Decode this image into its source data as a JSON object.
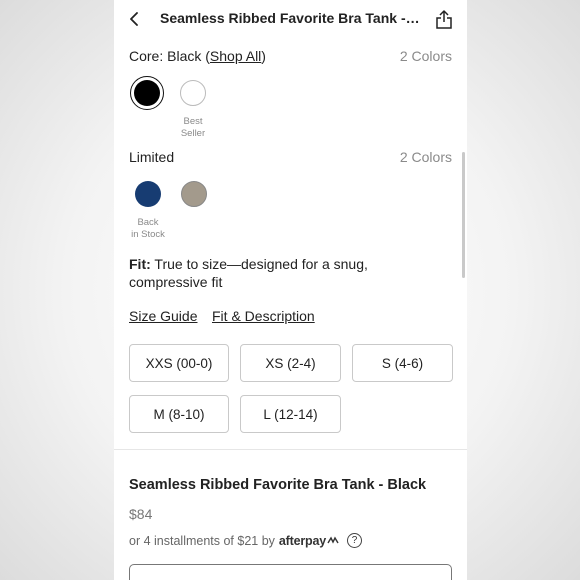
{
  "header": {
    "title": "Seamless Ribbed Favorite Bra Tank - B...",
    "back_icon": "chevron-left-icon",
    "share_icon": "share-icon"
  },
  "core": {
    "prefix": "Core: Black (",
    "shop_all": "Shop All",
    "suffix": ")",
    "count": "2 Colors",
    "swatches": [
      {
        "name": "Black",
        "color": "#000000",
        "selected": true,
        "note": ""
      },
      {
        "name": "White",
        "color": "#ffffff",
        "selected": false,
        "note_line1": "Best",
        "note_line2": "Seller"
      }
    ]
  },
  "limited": {
    "label": "Limited",
    "count": "2 Colors",
    "swatches": [
      {
        "name": "Navy",
        "color": "#173c72",
        "note_line1": "Back",
        "note_line2": "in Stock"
      },
      {
        "name": "Taupe",
        "color": "#a39a8c",
        "note_line1": "",
        "note_line2": ""
      }
    ]
  },
  "fit": {
    "label": "Fit:",
    "text": "True to size—designed for a snug, compressive fit"
  },
  "links": {
    "size_guide": "Size Guide",
    "fit_description": "Fit & Description"
  },
  "sizes": [
    "XXS (00-0)",
    "XS (2-4)",
    "S (4-6)",
    "M (8-10)",
    "L (12-14)"
  ],
  "product": {
    "name": "Seamless Ribbed Favorite Bra Tank - Black",
    "price": "$84",
    "installments": "or 4 installments of $21 by",
    "afterpay": "afterpay",
    "help_icon": "question-circle-icon"
  }
}
